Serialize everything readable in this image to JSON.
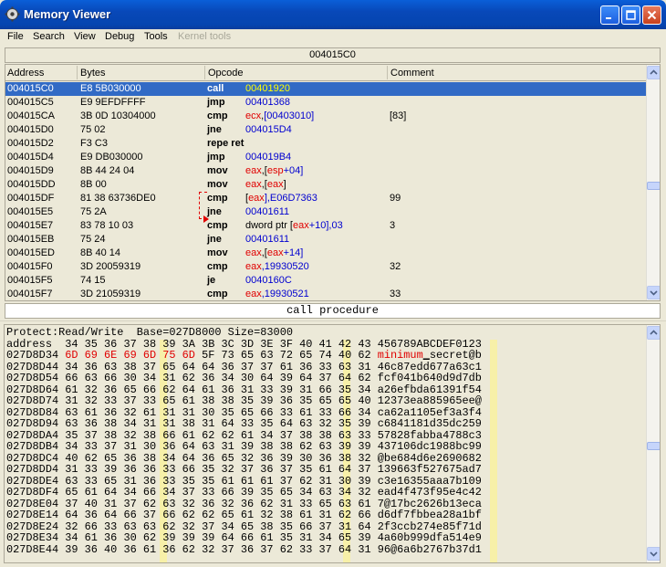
{
  "window": {
    "title": "Memory Viewer",
    "buttons": [
      "minimize",
      "maximize",
      "close"
    ]
  },
  "menu": {
    "items": [
      {
        "label": "File",
        "enabled": true
      },
      {
        "label": "Search",
        "enabled": true
      },
      {
        "label": "View",
        "enabled": true
      },
      {
        "label": "Debug",
        "enabled": true
      },
      {
        "label": "Tools",
        "enabled": true
      },
      {
        "label": "Kernel tools",
        "enabled": false
      }
    ]
  },
  "disassembler": {
    "current_address": "004015C0",
    "columns": {
      "address": "Address",
      "bytes": "Bytes",
      "opcode": "Opcode",
      "comment": "Comment"
    },
    "rows": [
      {
        "address": "004015C0",
        "bytes": "E8 5B030000",
        "op": "call",
        "args": [
          {
            "t": "00401920",
            "c": "tgt"
          }
        ],
        "comment": "",
        "selected": true
      },
      {
        "address": "004015C5",
        "bytes": "E9 9EFDFFFF",
        "op": "jmp",
        "args": [
          {
            "t": "00401368",
            "c": "tgt"
          }
        ],
        "comment": ""
      },
      {
        "address": "004015CA",
        "bytes": "3B 0D 10304000",
        "op": "cmp",
        "args": [
          {
            "t": "ecx",
            "c": "reg"
          },
          {
            "t": ",",
            "c": ""
          },
          {
            "t": "[00403010]",
            "c": "num"
          }
        ],
        "comment": "[83]"
      },
      {
        "address": "004015D0",
        "bytes": "75 02",
        "op": "jne",
        "args": [
          {
            "t": "004015D4",
            "c": "tgt"
          }
        ],
        "comment": ""
      },
      {
        "address": "004015D2",
        "bytes": "F3 C3",
        "op": "repe ret",
        "args": [],
        "comment": ""
      },
      {
        "address": "004015D4",
        "bytes": "E9 DB030000",
        "op": "jmp",
        "args": [
          {
            "t": "004019B4",
            "c": "tgt"
          }
        ],
        "comment": ""
      },
      {
        "address": "004015D9",
        "bytes": "8B 44 24 04",
        "op": "mov",
        "args": [
          {
            "t": "eax",
            "c": "reg"
          },
          {
            "t": ",[",
            "c": ""
          },
          {
            "t": "esp",
            "c": "reg"
          },
          {
            "t": "+04]",
            "c": "num"
          }
        ],
        "comment": ""
      },
      {
        "address": "004015DD",
        "bytes": "8B 00",
        "op": "mov",
        "args": [
          {
            "t": "eax",
            "c": "reg"
          },
          {
            "t": ",[",
            "c": ""
          },
          {
            "t": "eax",
            "c": "reg"
          },
          {
            "t": "]",
            "c": ""
          }
        ],
        "comment": ""
      },
      {
        "address": "004015DF",
        "bytes": "81 38 63736DE0",
        "op": "cmp",
        "args": [
          {
            "t": "[",
            "c": ""
          },
          {
            "t": "eax",
            "c": "reg"
          },
          {
            "t": "],E06D7363",
            "c": "num"
          }
        ],
        "comment": "99"
      },
      {
        "address": "004015E5",
        "bytes": "75 2A",
        "op": "jne",
        "args": [
          {
            "t": "00401611",
            "c": "tgt"
          }
        ],
        "comment": ""
      },
      {
        "address": "004015E7",
        "bytes": "83 78 10 03",
        "op": "cmp",
        "args": [
          {
            "t": "dword ptr [",
            "c": ""
          },
          {
            "t": "eax",
            "c": "reg"
          },
          {
            "t": "+10],03",
            "c": "num"
          }
        ],
        "comment": "3"
      },
      {
        "address": "004015EB",
        "bytes": "75 24",
        "op": "jne",
        "args": [
          {
            "t": "00401611",
            "c": "tgt"
          }
        ],
        "comment": ""
      },
      {
        "address": "004015ED",
        "bytes": "8B 40 14",
        "op": "mov",
        "args": [
          {
            "t": "eax",
            "c": "reg"
          },
          {
            "t": ",[",
            "c": ""
          },
          {
            "t": "eax",
            "c": "reg"
          },
          {
            "t": "+14]",
            "c": "num"
          }
        ],
        "comment": ""
      },
      {
        "address": "004015F0",
        "bytes": "3D 20059319",
        "op": "cmp",
        "args": [
          {
            "t": "eax",
            "c": "reg"
          },
          {
            "t": ",19930520",
            "c": "num"
          }
        ],
        "comment": "32"
      },
      {
        "address": "004015F5",
        "bytes": "74 15",
        "op": "je",
        "args": [
          {
            "t": "0040160C",
            "c": "tgt"
          }
        ],
        "comment": ""
      },
      {
        "address": "004015F7",
        "bytes": "3D 21059319",
        "op": "cmp",
        "args": [
          {
            "t": "eax",
            "c": "reg"
          },
          {
            "t": ",19930521",
            "c": "num"
          }
        ],
        "comment": "33"
      }
    ]
  },
  "procedure_label": "call procedure",
  "hex": {
    "info": "Protect:Read/Write  Base=027D8000 Size=83000",
    "header": "address  34 35 36 37 38 39 3A 3B 3C 3D 3E 3F 40 41 42 43 456789ABCDEF0123",
    "rows": [
      [
        "027D8D34",
        "6D 69 6E 69 6D 75 6D 5F 73 65 63 72 65 74 40 62",
        "minimum_secret@b"
      ],
      [
        "027D8D44",
        "34 36 63 38 37 65 64 64 36 37 37 61 36 33 63 31",
        "46c87edd677a63c1"
      ],
      [
        "027D8D54",
        "66 63 66 30 34 31 62 36 34 30 64 39 64 37 64 62",
        "fcf041b640d9d7db"
      ],
      [
        "027D8D64",
        "61 32 36 65 66 62 64 61 36 31 33 39 31 66 35 34",
        "a26efbda61391f54"
      ],
      [
        "027D8D74",
        "31 32 33 37 33 65 61 38 38 35 39 36 35 65 65 40",
        "12373ea885965ee@"
      ],
      [
        "027D8D84",
        "63 61 36 32 61 31 31 30 35 65 66 33 61 33 66 34",
        "ca62a1105ef3a3f4"
      ],
      [
        "027D8D94",
        "63 36 38 34 31 31 38 31 64 33 35 64 63 32 35 39",
        "c6841181d35dc259"
      ],
      [
        "027D8DA4",
        "35 37 38 32 38 66 61 62 62 61 34 37 38 38 63 33",
        "57828fabba4788c3"
      ],
      [
        "027D8DB4",
        "34 33 37 31 30 36 64 63 31 39 38 38 62 63 39 39",
        "437106dc1988bc99"
      ],
      [
        "027D8DC4",
        "40 62 65 36 38 34 64 36 65 32 36 39 30 36 38 32",
        "@be684d6e2690682"
      ],
      [
        "027D8DD4",
        "31 33 39 36 36 33 66 35 32 37 36 37 35 61 64 37",
        "139663f527675ad7"
      ],
      [
        "027D8DE4",
        "63 33 65 31 36 33 35 35 61 61 61 37 62 31 30 39",
        "c3e16355aaa7b109"
      ],
      [
        "027D8DF4",
        "65 61 64 34 66 34 37 33 66 39 35 65 34 63 34 32",
        "ead4f473f95e4c42"
      ],
      [
        "027D8E04",
        "37 40 31 37 62 63 32 36 32 36 62 31 33 65 63 61",
        "7@17bc2626b13eca"
      ],
      [
        "027D8E14",
        "64 36 64 66 37 66 62 62 65 61 32 38 61 31 62 66",
        "d6df7fbbea28a1bf"
      ],
      [
        "027D8E24",
        "32 66 33 63 63 62 32 37 34 65 38 35 66 37 31 64",
        "2f3ccb274e85f71d"
      ],
      [
        "027D8E34",
        "34 61 36 30 62 39 39 39 64 66 61 35 31 34 65 39",
        "4a60b999dfa514e9"
      ],
      [
        "027D8E44",
        "39 36 40 36 61 36 62 32 37 36 37 62 33 37 64 31",
        "96@6a6b2767b37d1"
      ]
    ]
  }
}
